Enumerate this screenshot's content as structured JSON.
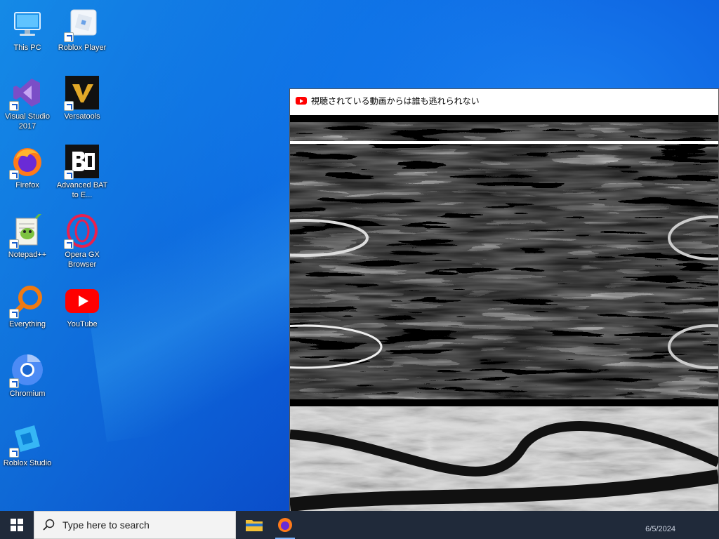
{
  "desktop": {
    "icons": [
      {
        "label": "This PC"
      },
      {
        "label": "Roblox Player"
      },
      {
        "label": "Visual Studio 2017"
      },
      {
        "label": "Versatools"
      },
      {
        "label": "Firefox"
      },
      {
        "label": "Advanced BAT to E..."
      },
      {
        "label": "Notepad++"
      },
      {
        "label": "Opera GX Browser"
      },
      {
        "label": "Everything"
      },
      {
        "label": "YouTube"
      },
      {
        "label": "Chromium"
      },
      {
        "label": "Roblox Studio"
      }
    ]
  },
  "video_window": {
    "title": "視聴されている動画からは誰も逃れられない",
    "icon": "youtube-icon"
  },
  "taskbar": {
    "search_placeholder": "Type here to search",
    "date": "6/5/2024",
    "apps": [
      "file-explorer-icon",
      "firefox-icon"
    ]
  },
  "colors": {
    "desktop_blue": "#0d63e0",
    "taskbar_bg": "#202a3a",
    "youtube_red": "#ff0000"
  }
}
